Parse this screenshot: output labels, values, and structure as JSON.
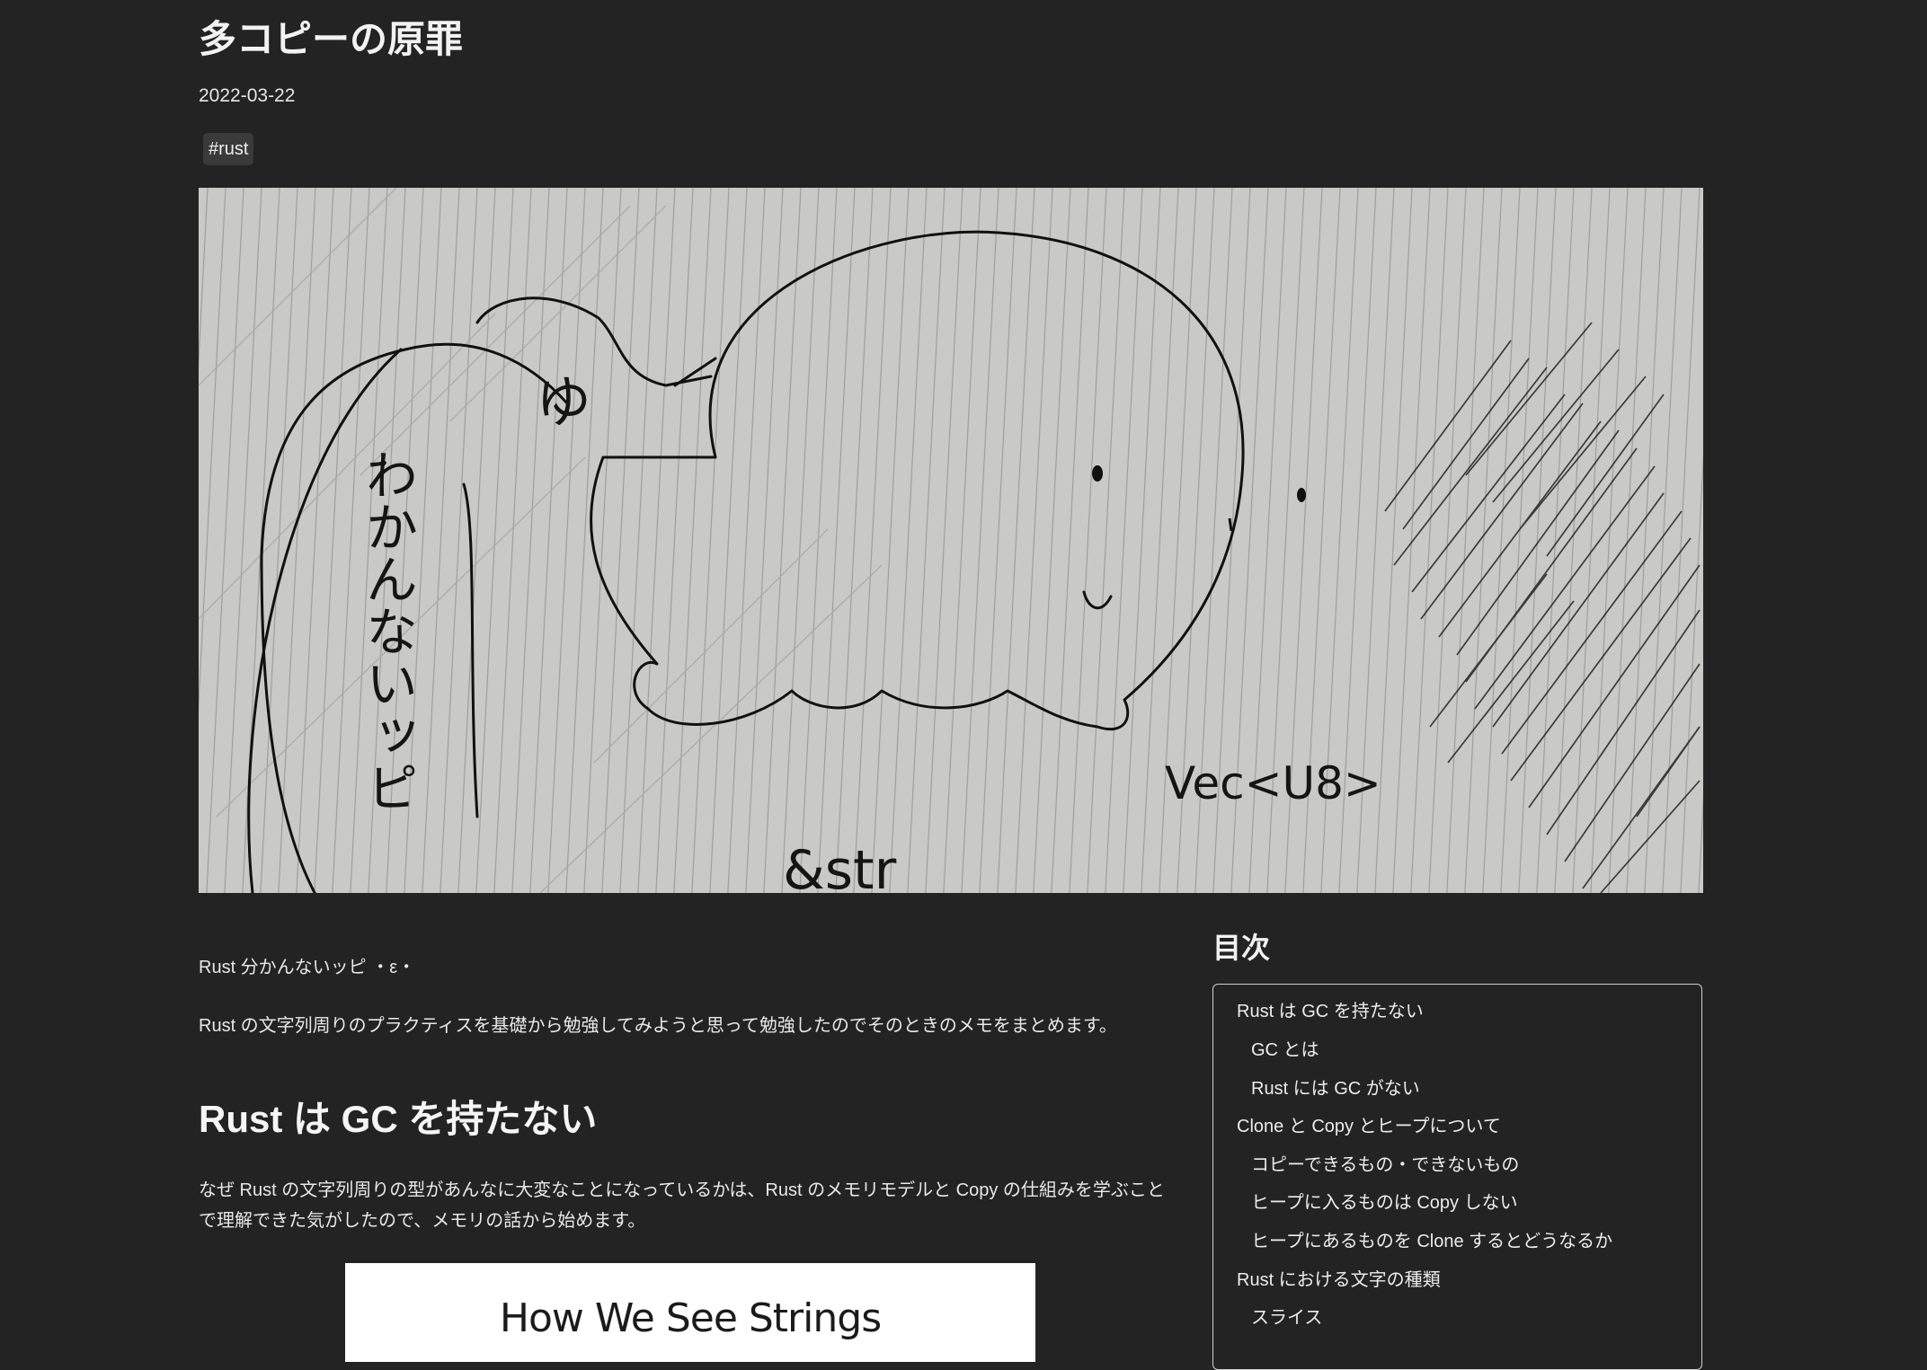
{
  "article": {
    "title": "多コピーの原罪",
    "date": "2022-03-22",
    "tag": "#rust"
  },
  "hero": {
    "handwriting_left": "わかんないッピ",
    "handwriting_bubble": "ゆ",
    "label_vec": "Vec<U8>",
    "label_str": "&str"
  },
  "content": {
    "intro": "Rust 分かんないッピ ・ε・",
    "lead": "Rust の文字列周りのプラクティスを基礎から勉強してみようと思って勉強したのでそのときのメモをまとめます。",
    "section_heading": "Rust は GC を持たない",
    "section_body": "なぜ Rust の文字列周りの型があんなに大変なことになっているかは、Rust のメモリモデルと Copy の仕組みを学ぶことで理解できた気がしたので、メモリの話から始めます。",
    "figure_caption": "How We See Strings"
  },
  "toc": {
    "heading": "目次",
    "items": [
      {
        "label": "Rust は GC を持たない"
      },
      {
        "label": "GC とは"
      },
      {
        "label": "Rust には GC がない"
      },
      {
        "label": "Clone と Copy とヒープについて"
      },
      {
        "label": "コピーできるもの・できないもの"
      },
      {
        "label": "ヒープに入るものは Copy しない"
      },
      {
        "label": "ヒープにあるものを Clone するとどうなるか"
      },
      {
        "label": "Rust における文字の種類"
      },
      {
        "label": "スライス"
      }
    ]
  }
}
